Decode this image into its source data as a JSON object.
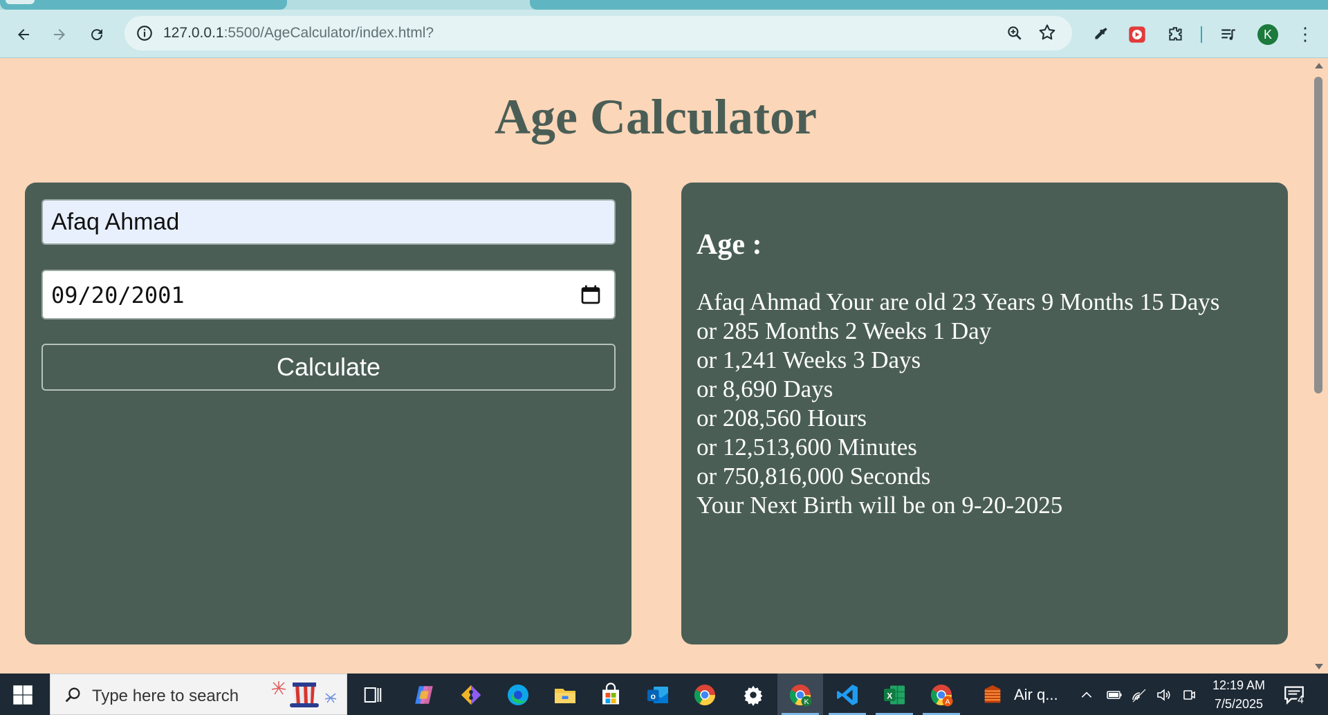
{
  "browser": {
    "url_host": "127.0.0.1",
    "url_rest": ":5500/AgeCalculator/index.html?",
    "profile_initial": "K"
  },
  "page": {
    "title": "Age Calculator",
    "name_value": "Afaq Ahmad",
    "date_value": "09/20/2001",
    "calculate_label": "Calculate",
    "age_heading": "Age :",
    "result_lines": [
      "Afaq Ahmad Your are old 23 Years 9 Months 15 Days",
      "or 285 Months 2 Weeks 1 Day",
      "or 1,241 Weeks 3 Days",
      "or 8,690 Days",
      "or 208,560 Hours",
      "or 12,513,600 Minutes",
      "or 750,816,000 Seconds",
      "Your Next Birth will be on 9-20-2025"
    ],
    "colors": {
      "background": "#fbd6b8",
      "panel": "#4a5e56",
      "title": "#4a5e56"
    }
  },
  "taskbar": {
    "search_placeholder": "Type here to search",
    "air_label": "Air q...",
    "time": "12:19 AM",
    "date": "7/5/2025",
    "notification_count": "4",
    "apps": [
      "task-view",
      "copilot",
      "git",
      "edge",
      "file-explorer",
      "store",
      "outlook",
      "chrome",
      "settings",
      "chrome-profile-k",
      "vscode",
      "excel",
      "chrome-profile-a",
      "weather"
    ]
  }
}
